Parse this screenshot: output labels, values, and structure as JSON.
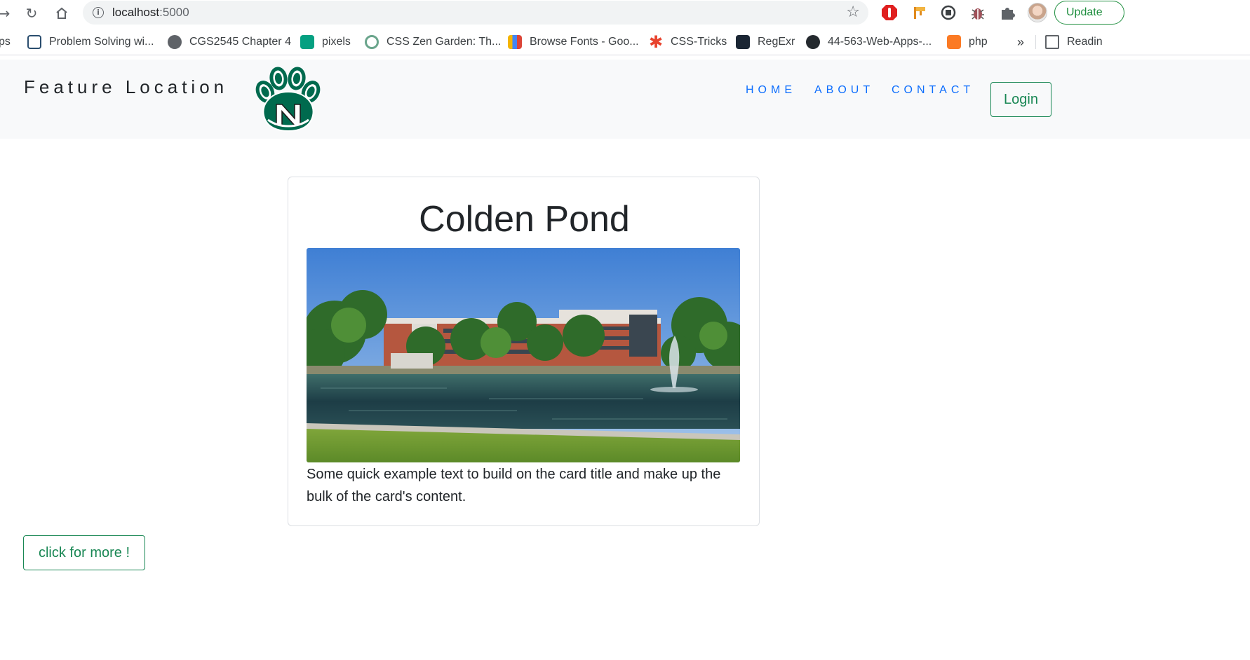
{
  "browser": {
    "url_host": "localhost",
    "url_port": ":5000",
    "update_label": "Update",
    "bookmarks": [
      {
        "label": "ps"
      },
      {
        "label": "Problem Solving wi..."
      },
      {
        "label": "CGS2545 Chapter 4"
      },
      {
        "label": "pixels"
      },
      {
        "label": "CSS Zen Garden: Th..."
      },
      {
        "label": "Browse Fonts - Goo..."
      },
      {
        "label": "CSS-Tricks"
      },
      {
        "label": "RegExr"
      },
      {
        "label": "44-563-Web-Apps-..."
      },
      {
        "label": "php"
      },
      {
        "label": "Readin"
      }
    ],
    "overflow_label": "»"
  },
  "navbar": {
    "brand": "Feature Location",
    "links": [
      "HOME",
      "ABOUT",
      "CONTACT"
    ],
    "login_label": "Login"
  },
  "card": {
    "title": "Colden Pond",
    "text": "Some quick example text to build on the card title and make up the bulk of the card's content."
  },
  "more_button_label": "click for more !",
  "colors": {
    "link_blue": "#0d6efd",
    "success_green": "#198754",
    "navbar_bg": "#f8f9fa",
    "logo_green": "#006a4e"
  }
}
